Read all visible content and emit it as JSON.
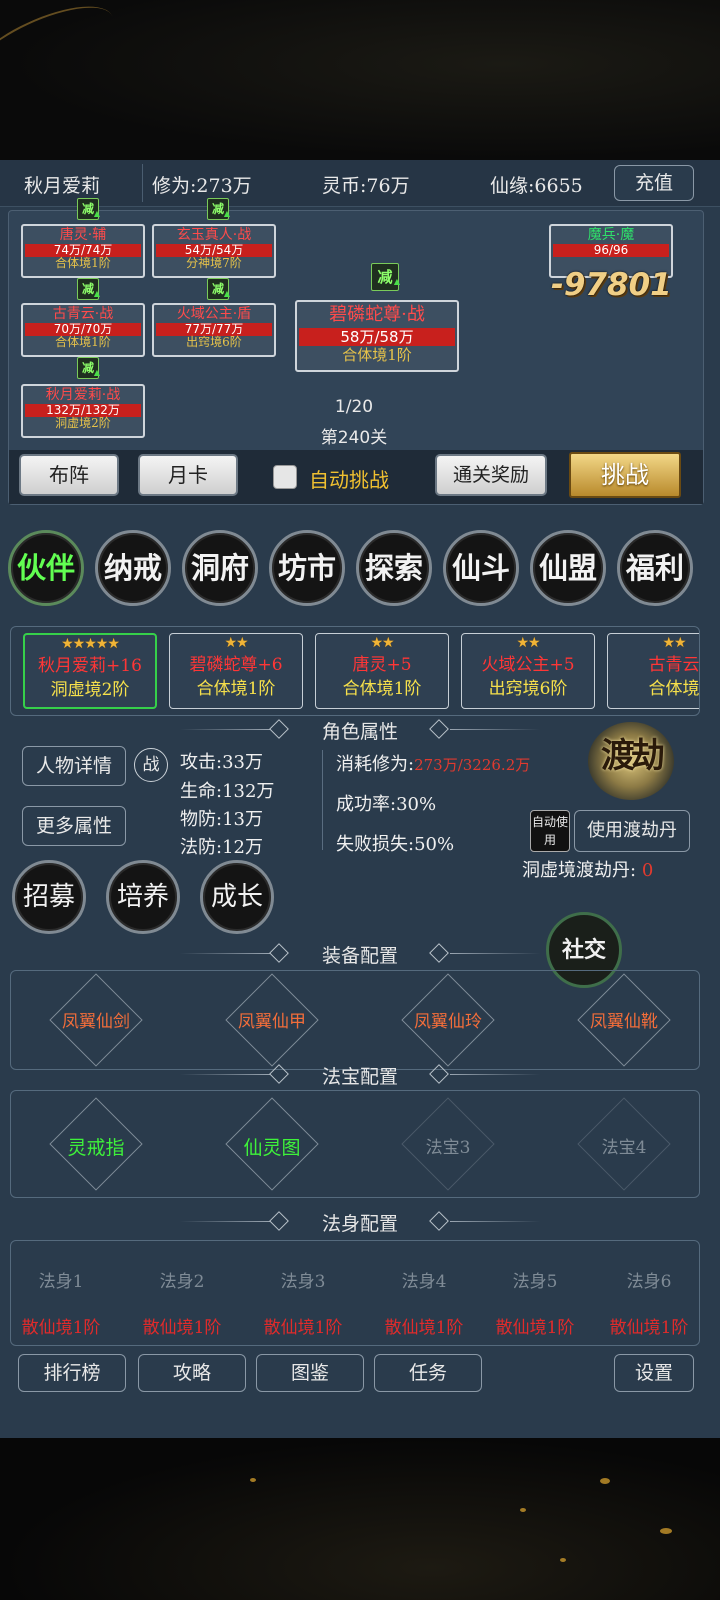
{
  "topbar": {
    "player_name": "秋月爱莉",
    "cultivation": "修为:273万",
    "spirit_coins": "灵币:76万",
    "fate": "仙缘:6655",
    "recharge_label": "充值"
  },
  "battle": {
    "ally_badge": "减",
    "allies": [
      {
        "name": "唐灵·辅",
        "hp": "74万/74万",
        "level": "合体境1阶"
      },
      {
        "name": "玄玉真人·战",
        "hp": "54万/54万",
        "level": "分神境7阶"
      },
      {
        "name": "古青云·战",
        "hp": "70万/70万",
        "level": "合体境1阶"
      },
      {
        "name": "火域公主·盾",
        "hp": "77万/77万",
        "level": "出窍境6阶"
      },
      {
        "name": "秋月爱莉·战",
        "hp": "132万/132万",
        "level": "洞虚境2阶"
      }
    ],
    "leader": {
      "name": "碧磷蛇尊·战",
      "hp": "58万/58万",
      "level": "合体境1阶"
    },
    "enemy": {
      "name": "魔兵·魔",
      "hp": "96/96"
    },
    "damage": "-97801",
    "wave": "1/20",
    "stage": "第240关",
    "buttons": {
      "formation": "布阵",
      "monthly_card": "月卡",
      "auto_challenge": "自动挑战",
      "clear_reward": "通关奖励",
      "challenge": "挑战"
    }
  },
  "menu": [
    "伙伴",
    "纳戒",
    "洞府",
    "坊市",
    "探索",
    "仙斗",
    "仙盟",
    "福利"
  ],
  "partners": [
    {
      "stars": "★★★★★",
      "name": "秋月爱莉+16",
      "level": "洞虚境2阶"
    },
    {
      "stars": "★★",
      "name": "碧磷蛇尊+6",
      "level": "合体境1阶"
    },
    {
      "stars": "★★",
      "name": "唐灵+5",
      "level": "合体境1阶"
    },
    {
      "stars": "★★",
      "name": "火域公主+5",
      "level": "出窍境6阶"
    },
    {
      "stars": "★★",
      "name": "古青云",
      "level": "合体境"
    }
  ],
  "attributes": {
    "title": "角色属性",
    "detail_button": "人物详情",
    "battle_tag": "战",
    "more_button": "更多属性",
    "attack": "攻击:33万",
    "life": "生命:132万",
    "phys_def": "物防:13万",
    "magic_def": "法防:12万",
    "cost_label": "消耗修为:",
    "cost_value": "273万/3226.2万",
    "success_rate": "成功率:30%",
    "fail_loss": "失败损失:50%",
    "dujie_label": "渡劫",
    "auto_use": "自动使用",
    "use_pill": "使用渡劫丹",
    "pill_label": "洞虚境渡劫丹:",
    "pill_count": "0"
  },
  "actions": [
    "招募",
    "培养",
    "成长"
  ],
  "social": "社交",
  "equipment": {
    "title": "装备配置",
    "items": [
      "凤翼仙剑",
      "凤翼仙甲",
      "凤翼仙玲",
      "凤翼仙靴"
    ]
  },
  "treasures": {
    "title": "法宝配置",
    "items": [
      "灵戒指",
      "仙灵图",
      "法宝3",
      "法宝4"
    ]
  },
  "bodies": {
    "title": "法身配置",
    "items": [
      {
        "name": "法身1",
        "level": "散仙境1阶"
      },
      {
        "name": "法身2",
        "level": "散仙境1阶"
      },
      {
        "name": "法身3",
        "level": "散仙境1阶"
      },
      {
        "name": "法身4",
        "level": "散仙境1阶"
      },
      {
        "name": "法身5",
        "level": "散仙境1阶"
      },
      {
        "name": "法身6",
        "level": "散仙境1阶"
      }
    ]
  },
  "footer": [
    "排行榜",
    "攻略",
    "图鉴",
    "任务",
    "设置"
  ]
}
